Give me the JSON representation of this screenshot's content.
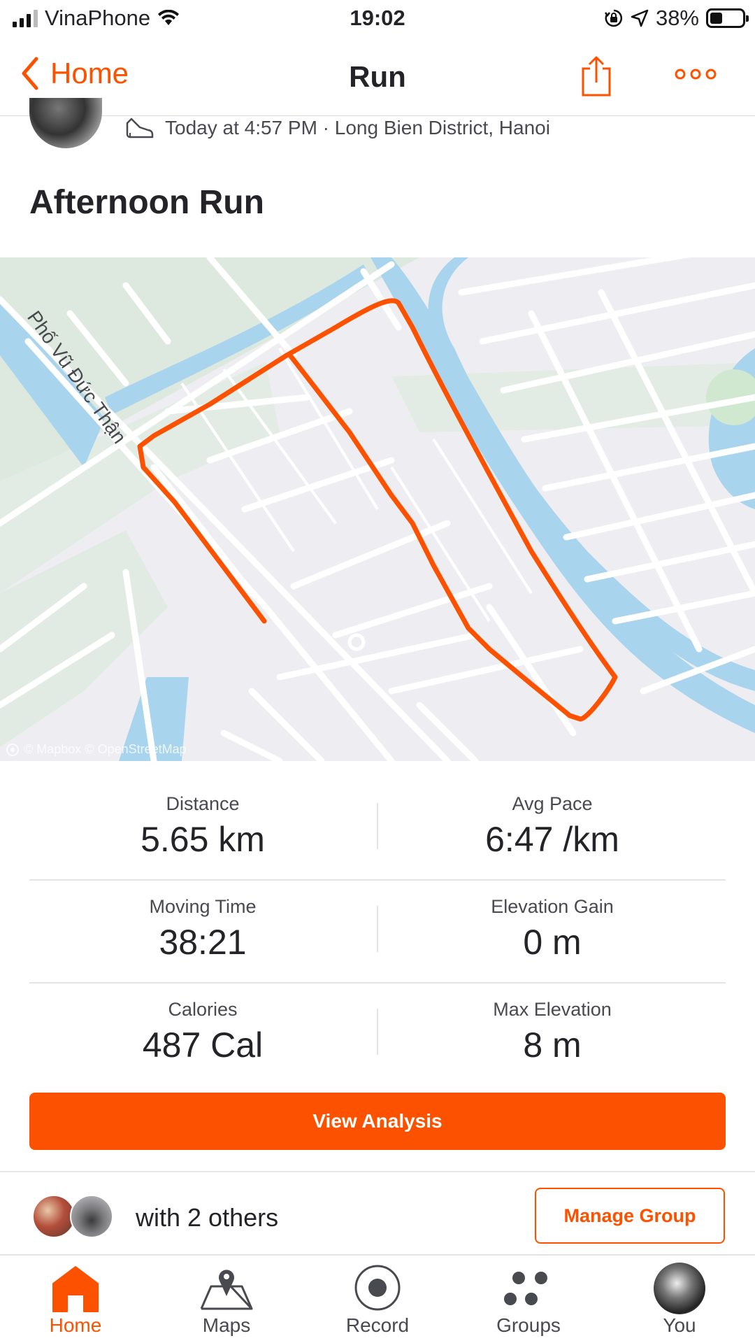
{
  "status_bar": {
    "carrier": "VinaPhone",
    "time": "19:02",
    "battery": "38%",
    "battery_level": 0.38
  },
  "nav": {
    "back_label": "Home",
    "title": "Run"
  },
  "activity": {
    "meta": "Today at 4:57 PM · Long Bien District, Hanoi",
    "title": "Afternoon Run"
  },
  "map": {
    "street_label": "Phố Vũ Đức Thận",
    "attribution": "© Mapbox © OpenStreetMap",
    "route_color": "#fc5200",
    "water_color": "#a9d4ee",
    "park_color": "#dde9df"
  },
  "stats": {
    "distance_label": "Distance",
    "distance_value": "5.65 km",
    "pace_label": "Avg Pace",
    "pace_value": "6:47 /km",
    "moving_time_label": "Moving Time",
    "moving_time_value": "38:21",
    "elevation_gain_label": "Elevation Gain",
    "elevation_gain_value": "0 m",
    "calories_label": "Calories",
    "calories_value": "487 Cal",
    "max_elevation_label": "Max Elevation",
    "max_elevation_value": "8 m"
  },
  "actions": {
    "view_analysis": "View Analysis"
  },
  "group": {
    "text": "with 2 others",
    "manage_label": "Manage Group"
  },
  "tabs": [
    {
      "label": "Home",
      "icon": "home-icon",
      "active": true
    },
    {
      "label": "Maps",
      "icon": "maps-icon",
      "active": false
    },
    {
      "label": "Record",
      "icon": "record-icon",
      "active": false
    },
    {
      "label": "Groups",
      "icon": "groups-icon",
      "active": false
    },
    {
      "label": "You",
      "icon": "profile-avatar",
      "active": false
    }
  ],
  "colors": {
    "accent": "#fc5200"
  }
}
